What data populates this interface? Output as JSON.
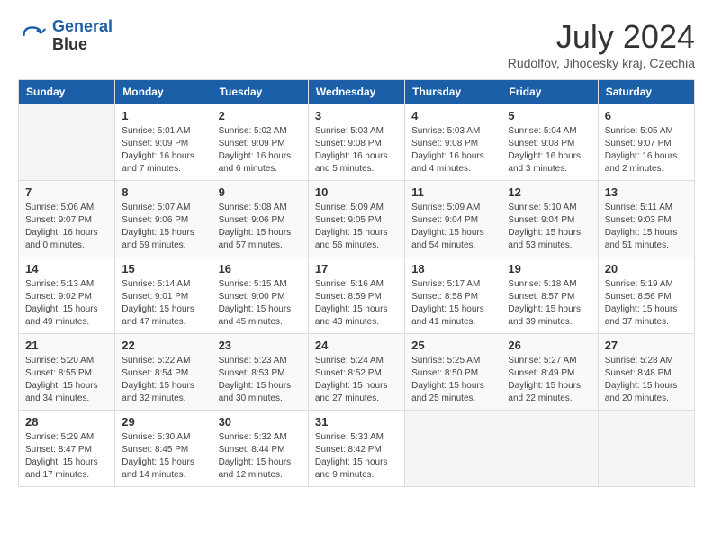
{
  "header": {
    "logo_line1": "General",
    "logo_line2": "Blue",
    "month_year": "July 2024",
    "location": "Rudolfov, Jihocesky kraj, Czechia"
  },
  "weekdays": [
    "Sunday",
    "Monday",
    "Tuesday",
    "Wednesday",
    "Thursday",
    "Friday",
    "Saturday"
  ],
  "weeks": [
    [
      {
        "day": "",
        "info": ""
      },
      {
        "day": "1",
        "info": "Sunrise: 5:01 AM\nSunset: 9:09 PM\nDaylight: 16 hours\nand 7 minutes."
      },
      {
        "day": "2",
        "info": "Sunrise: 5:02 AM\nSunset: 9:09 PM\nDaylight: 16 hours\nand 6 minutes."
      },
      {
        "day": "3",
        "info": "Sunrise: 5:03 AM\nSunset: 9:08 PM\nDaylight: 16 hours\nand 5 minutes."
      },
      {
        "day": "4",
        "info": "Sunrise: 5:03 AM\nSunset: 9:08 PM\nDaylight: 16 hours\nand 4 minutes."
      },
      {
        "day": "5",
        "info": "Sunrise: 5:04 AM\nSunset: 9:08 PM\nDaylight: 16 hours\nand 3 minutes."
      },
      {
        "day": "6",
        "info": "Sunrise: 5:05 AM\nSunset: 9:07 PM\nDaylight: 16 hours\nand 2 minutes."
      }
    ],
    [
      {
        "day": "7",
        "info": "Sunrise: 5:06 AM\nSunset: 9:07 PM\nDaylight: 16 hours\nand 0 minutes."
      },
      {
        "day": "8",
        "info": "Sunrise: 5:07 AM\nSunset: 9:06 PM\nDaylight: 15 hours\nand 59 minutes."
      },
      {
        "day": "9",
        "info": "Sunrise: 5:08 AM\nSunset: 9:06 PM\nDaylight: 15 hours\nand 57 minutes."
      },
      {
        "day": "10",
        "info": "Sunrise: 5:09 AM\nSunset: 9:05 PM\nDaylight: 15 hours\nand 56 minutes."
      },
      {
        "day": "11",
        "info": "Sunrise: 5:09 AM\nSunset: 9:04 PM\nDaylight: 15 hours\nand 54 minutes."
      },
      {
        "day": "12",
        "info": "Sunrise: 5:10 AM\nSunset: 9:04 PM\nDaylight: 15 hours\nand 53 minutes."
      },
      {
        "day": "13",
        "info": "Sunrise: 5:11 AM\nSunset: 9:03 PM\nDaylight: 15 hours\nand 51 minutes."
      }
    ],
    [
      {
        "day": "14",
        "info": "Sunrise: 5:13 AM\nSunset: 9:02 PM\nDaylight: 15 hours\nand 49 minutes."
      },
      {
        "day": "15",
        "info": "Sunrise: 5:14 AM\nSunset: 9:01 PM\nDaylight: 15 hours\nand 47 minutes."
      },
      {
        "day": "16",
        "info": "Sunrise: 5:15 AM\nSunset: 9:00 PM\nDaylight: 15 hours\nand 45 minutes."
      },
      {
        "day": "17",
        "info": "Sunrise: 5:16 AM\nSunset: 8:59 PM\nDaylight: 15 hours\nand 43 minutes."
      },
      {
        "day": "18",
        "info": "Sunrise: 5:17 AM\nSunset: 8:58 PM\nDaylight: 15 hours\nand 41 minutes."
      },
      {
        "day": "19",
        "info": "Sunrise: 5:18 AM\nSunset: 8:57 PM\nDaylight: 15 hours\nand 39 minutes."
      },
      {
        "day": "20",
        "info": "Sunrise: 5:19 AM\nSunset: 8:56 PM\nDaylight: 15 hours\nand 37 minutes."
      }
    ],
    [
      {
        "day": "21",
        "info": "Sunrise: 5:20 AM\nSunset: 8:55 PM\nDaylight: 15 hours\nand 34 minutes."
      },
      {
        "day": "22",
        "info": "Sunrise: 5:22 AM\nSunset: 8:54 PM\nDaylight: 15 hours\nand 32 minutes."
      },
      {
        "day": "23",
        "info": "Sunrise: 5:23 AM\nSunset: 8:53 PM\nDaylight: 15 hours\nand 30 minutes."
      },
      {
        "day": "24",
        "info": "Sunrise: 5:24 AM\nSunset: 8:52 PM\nDaylight: 15 hours\nand 27 minutes."
      },
      {
        "day": "25",
        "info": "Sunrise: 5:25 AM\nSunset: 8:50 PM\nDaylight: 15 hours\nand 25 minutes."
      },
      {
        "day": "26",
        "info": "Sunrise: 5:27 AM\nSunset: 8:49 PM\nDaylight: 15 hours\nand 22 minutes."
      },
      {
        "day": "27",
        "info": "Sunrise: 5:28 AM\nSunset: 8:48 PM\nDaylight: 15 hours\nand 20 minutes."
      }
    ],
    [
      {
        "day": "28",
        "info": "Sunrise: 5:29 AM\nSunset: 8:47 PM\nDaylight: 15 hours\nand 17 minutes."
      },
      {
        "day": "29",
        "info": "Sunrise: 5:30 AM\nSunset: 8:45 PM\nDaylight: 15 hours\nand 14 minutes."
      },
      {
        "day": "30",
        "info": "Sunrise: 5:32 AM\nSunset: 8:44 PM\nDaylight: 15 hours\nand 12 minutes."
      },
      {
        "day": "31",
        "info": "Sunrise: 5:33 AM\nSunset: 8:42 PM\nDaylight: 15 hours\nand 9 minutes."
      },
      {
        "day": "",
        "info": ""
      },
      {
        "day": "",
        "info": ""
      },
      {
        "day": "",
        "info": ""
      }
    ]
  ]
}
